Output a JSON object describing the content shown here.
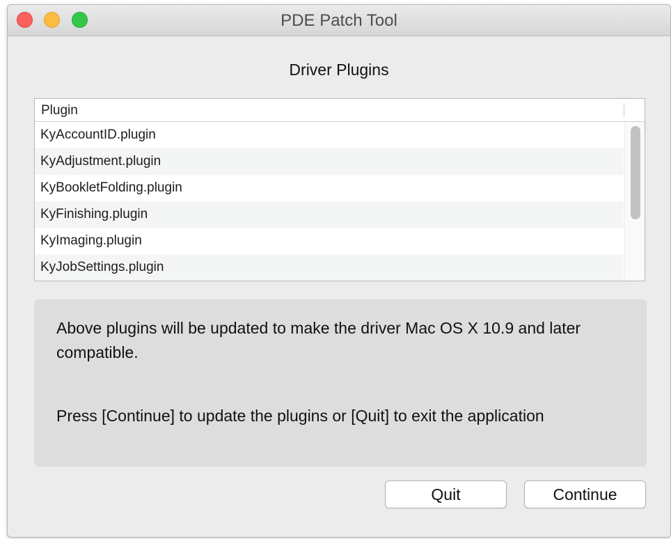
{
  "window": {
    "title": "PDE Patch Tool"
  },
  "heading": "Driver Plugins",
  "table": {
    "column_header": "Plugin",
    "rows": [
      "KyAccountID.plugin",
      "KyAdjustment.plugin",
      "KyBookletFolding.plugin",
      "KyFinishing.plugin",
      "KyImaging.plugin",
      "KyJobSettings.plugin"
    ]
  },
  "message": {
    "line1": "Above plugins will be updated to make the driver Mac OS X 10.9 and later compatible.",
    "line2": "Press [Continue] to update the plugins or [Quit] to exit the application"
  },
  "buttons": {
    "quit": "Quit",
    "continue": "Continue"
  },
  "colors": {
    "close": "#fc605c",
    "minimize": "#fdbc40",
    "maximize": "#34c84a"
  }
}
